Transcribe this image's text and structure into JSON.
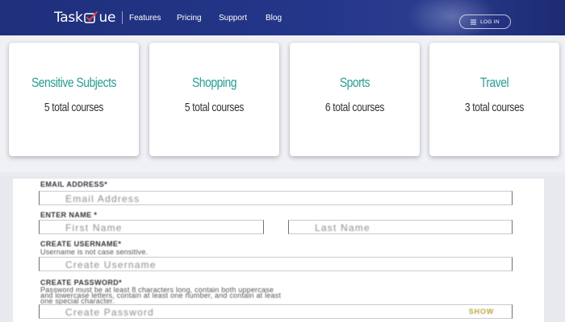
{
  "header": {
    "logo_text_left": "Task",
    "logo_text_right": "ue",
    "nav": [
      {
        "label": "Features"
      },
      {
        "label": "Pricing"
      },
      {
        "label": "Support"
      },
      {
        "label": "Blog"
      }
    ],
    "login_label": "LOG IN",
    "login_icon": "login-menu-icon",
    "colors": {
      "header_bg": "#243689",
      "accent": "#2a9d95"
    }
  },
  "categories": [
    {
      "title": "Sensitive Subjects",
      "count": "5 total courses"
    },
    {
      "title": "Shopping",
      "count": "5 total courses"
    },
    {
      "title": "Sports",
      "count": "6 total courses"
    },
    {
      "title": "Travel",
      "count": "3 total courses"
    }
  ],
  "form": {
    "email_label": "EMAIL ADDRESS*",
    "email_placeholder": "Email Address",
    "name_label": "ENTER NAME *",
    "first_placeholder": "First Name",
    "last_placeholder": "Last Name",
    "username_label": "CREATE USERNAME*",
    "username_help": "Username is not case sensitive.",
    "username_placeholder": "Create Username",
    "password_label": "CREATE PASSWORD*",
    "password_help_1": "Password must be at least 8 characters long, contain both uppercase",
    "password_help_2": "and lowercase letters, contain at least one number, and contain at least",
    "password_help_3": "one special character.",
    "password_placeholder": "Create Password",
    "show_label": "SHOW"
  }
}
